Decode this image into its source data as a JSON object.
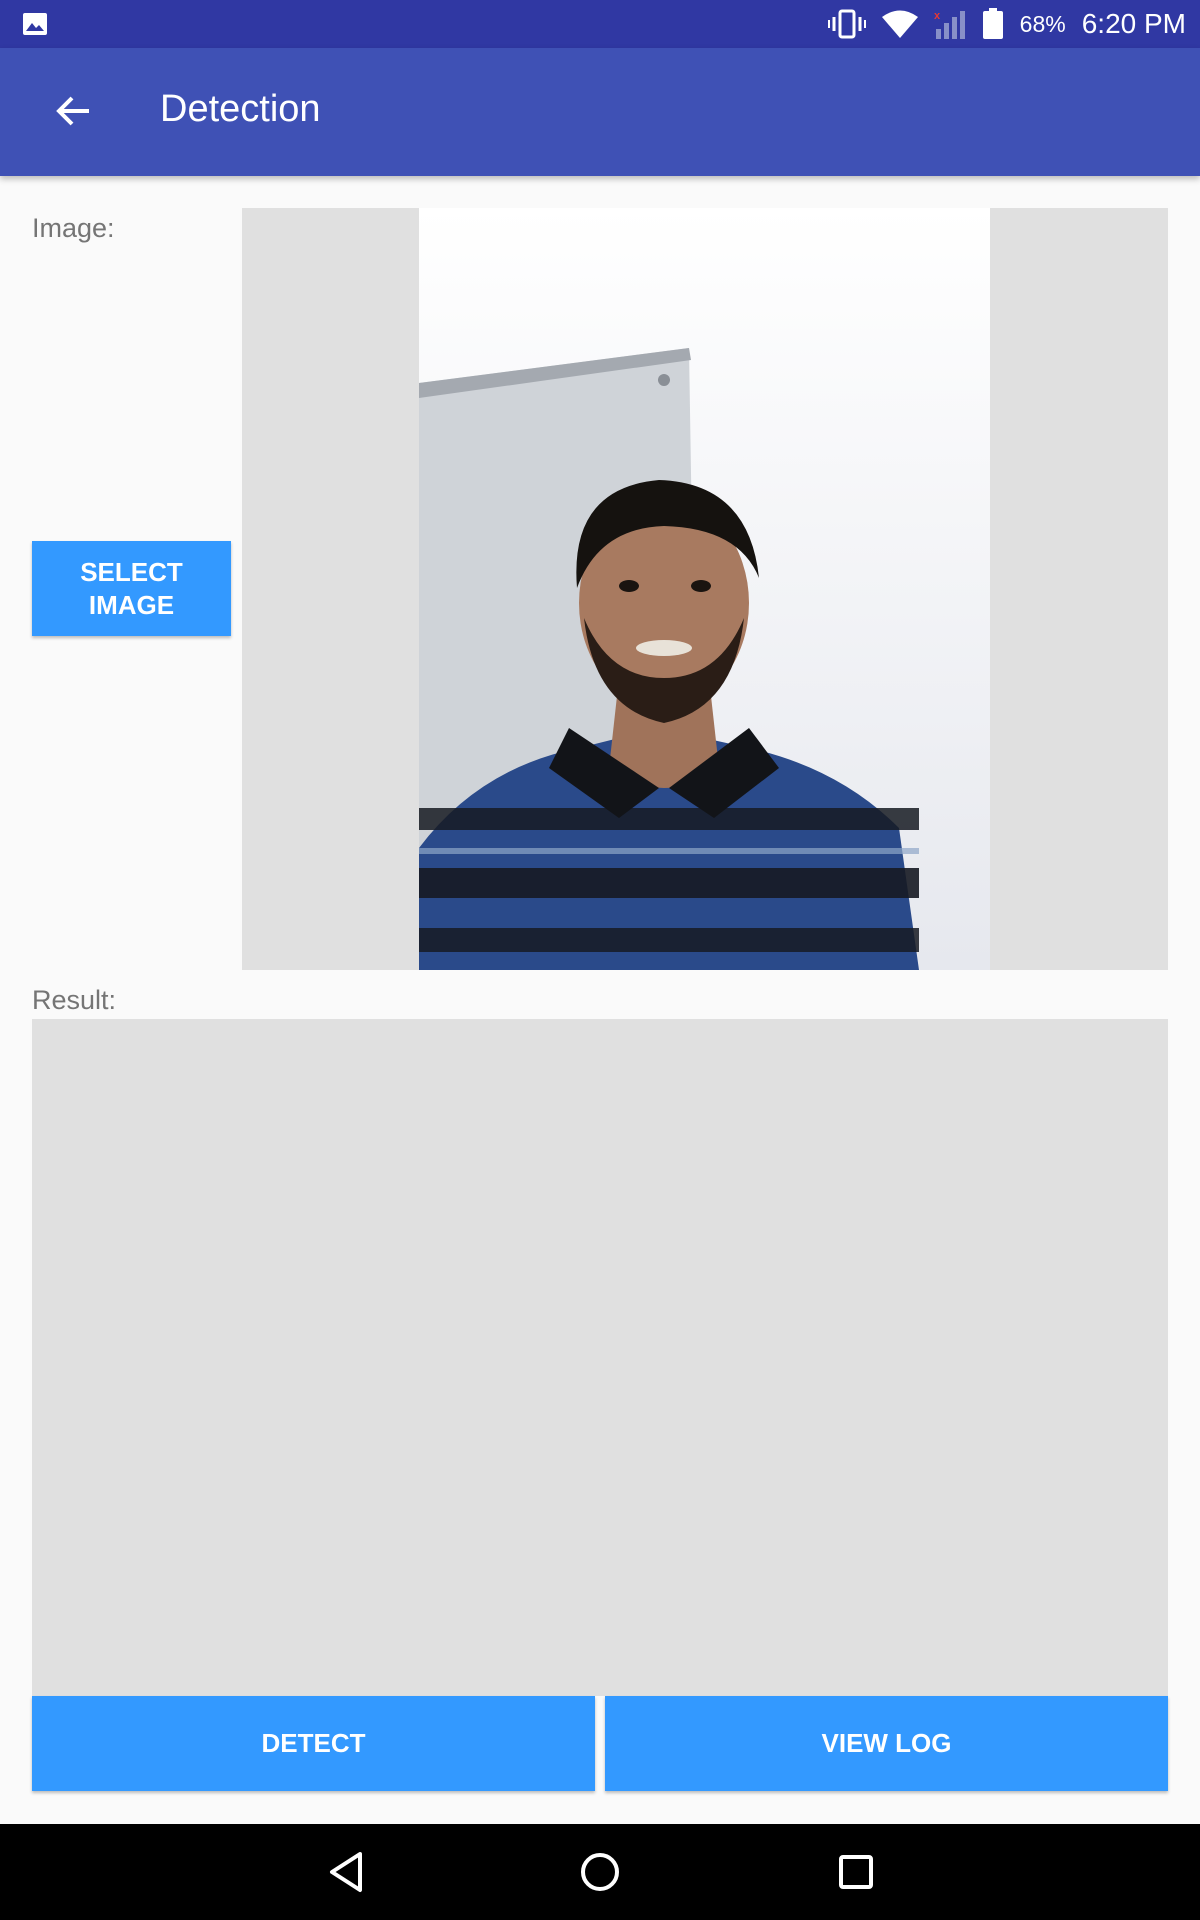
{
  "status_bar": {
    "battery_percent": "68%",
    "time": "6:20 PM",
    "icons": [
      "image-notification-icon",
      "vibrate-icon",
      "wifi-icon",
      "cell-signal-icon",
      "battery-icon"
    ]
  },
  "app_bar": {
    "title": "Detection",
    "back_icon": "arrow-back-icon"
  },
  "image_section": {
    "label": "Image:",
    "select_button": {
      "line1": "SELECT",
      "line2": "IMAGE"
    }
  },
  "result_section": {
    "label": "Result:"
  },
  "actions": {
    "detect_label": "DETECT",
    "view_log_label": "VIEW LOG"
  },
  "nav_bar": {
    "icons": [
      "back-triangle-icon",
      "home-circle-icon",
      "recents-square-icon"
    ]
  },
  "colors": {
    "status_bar": "#3038a3",
    "app_bar": "#3f51b5",
    "button": "#3399ff",
    "panel": "#e0e0e0",
    "background": "#fafafa"
  }
}
